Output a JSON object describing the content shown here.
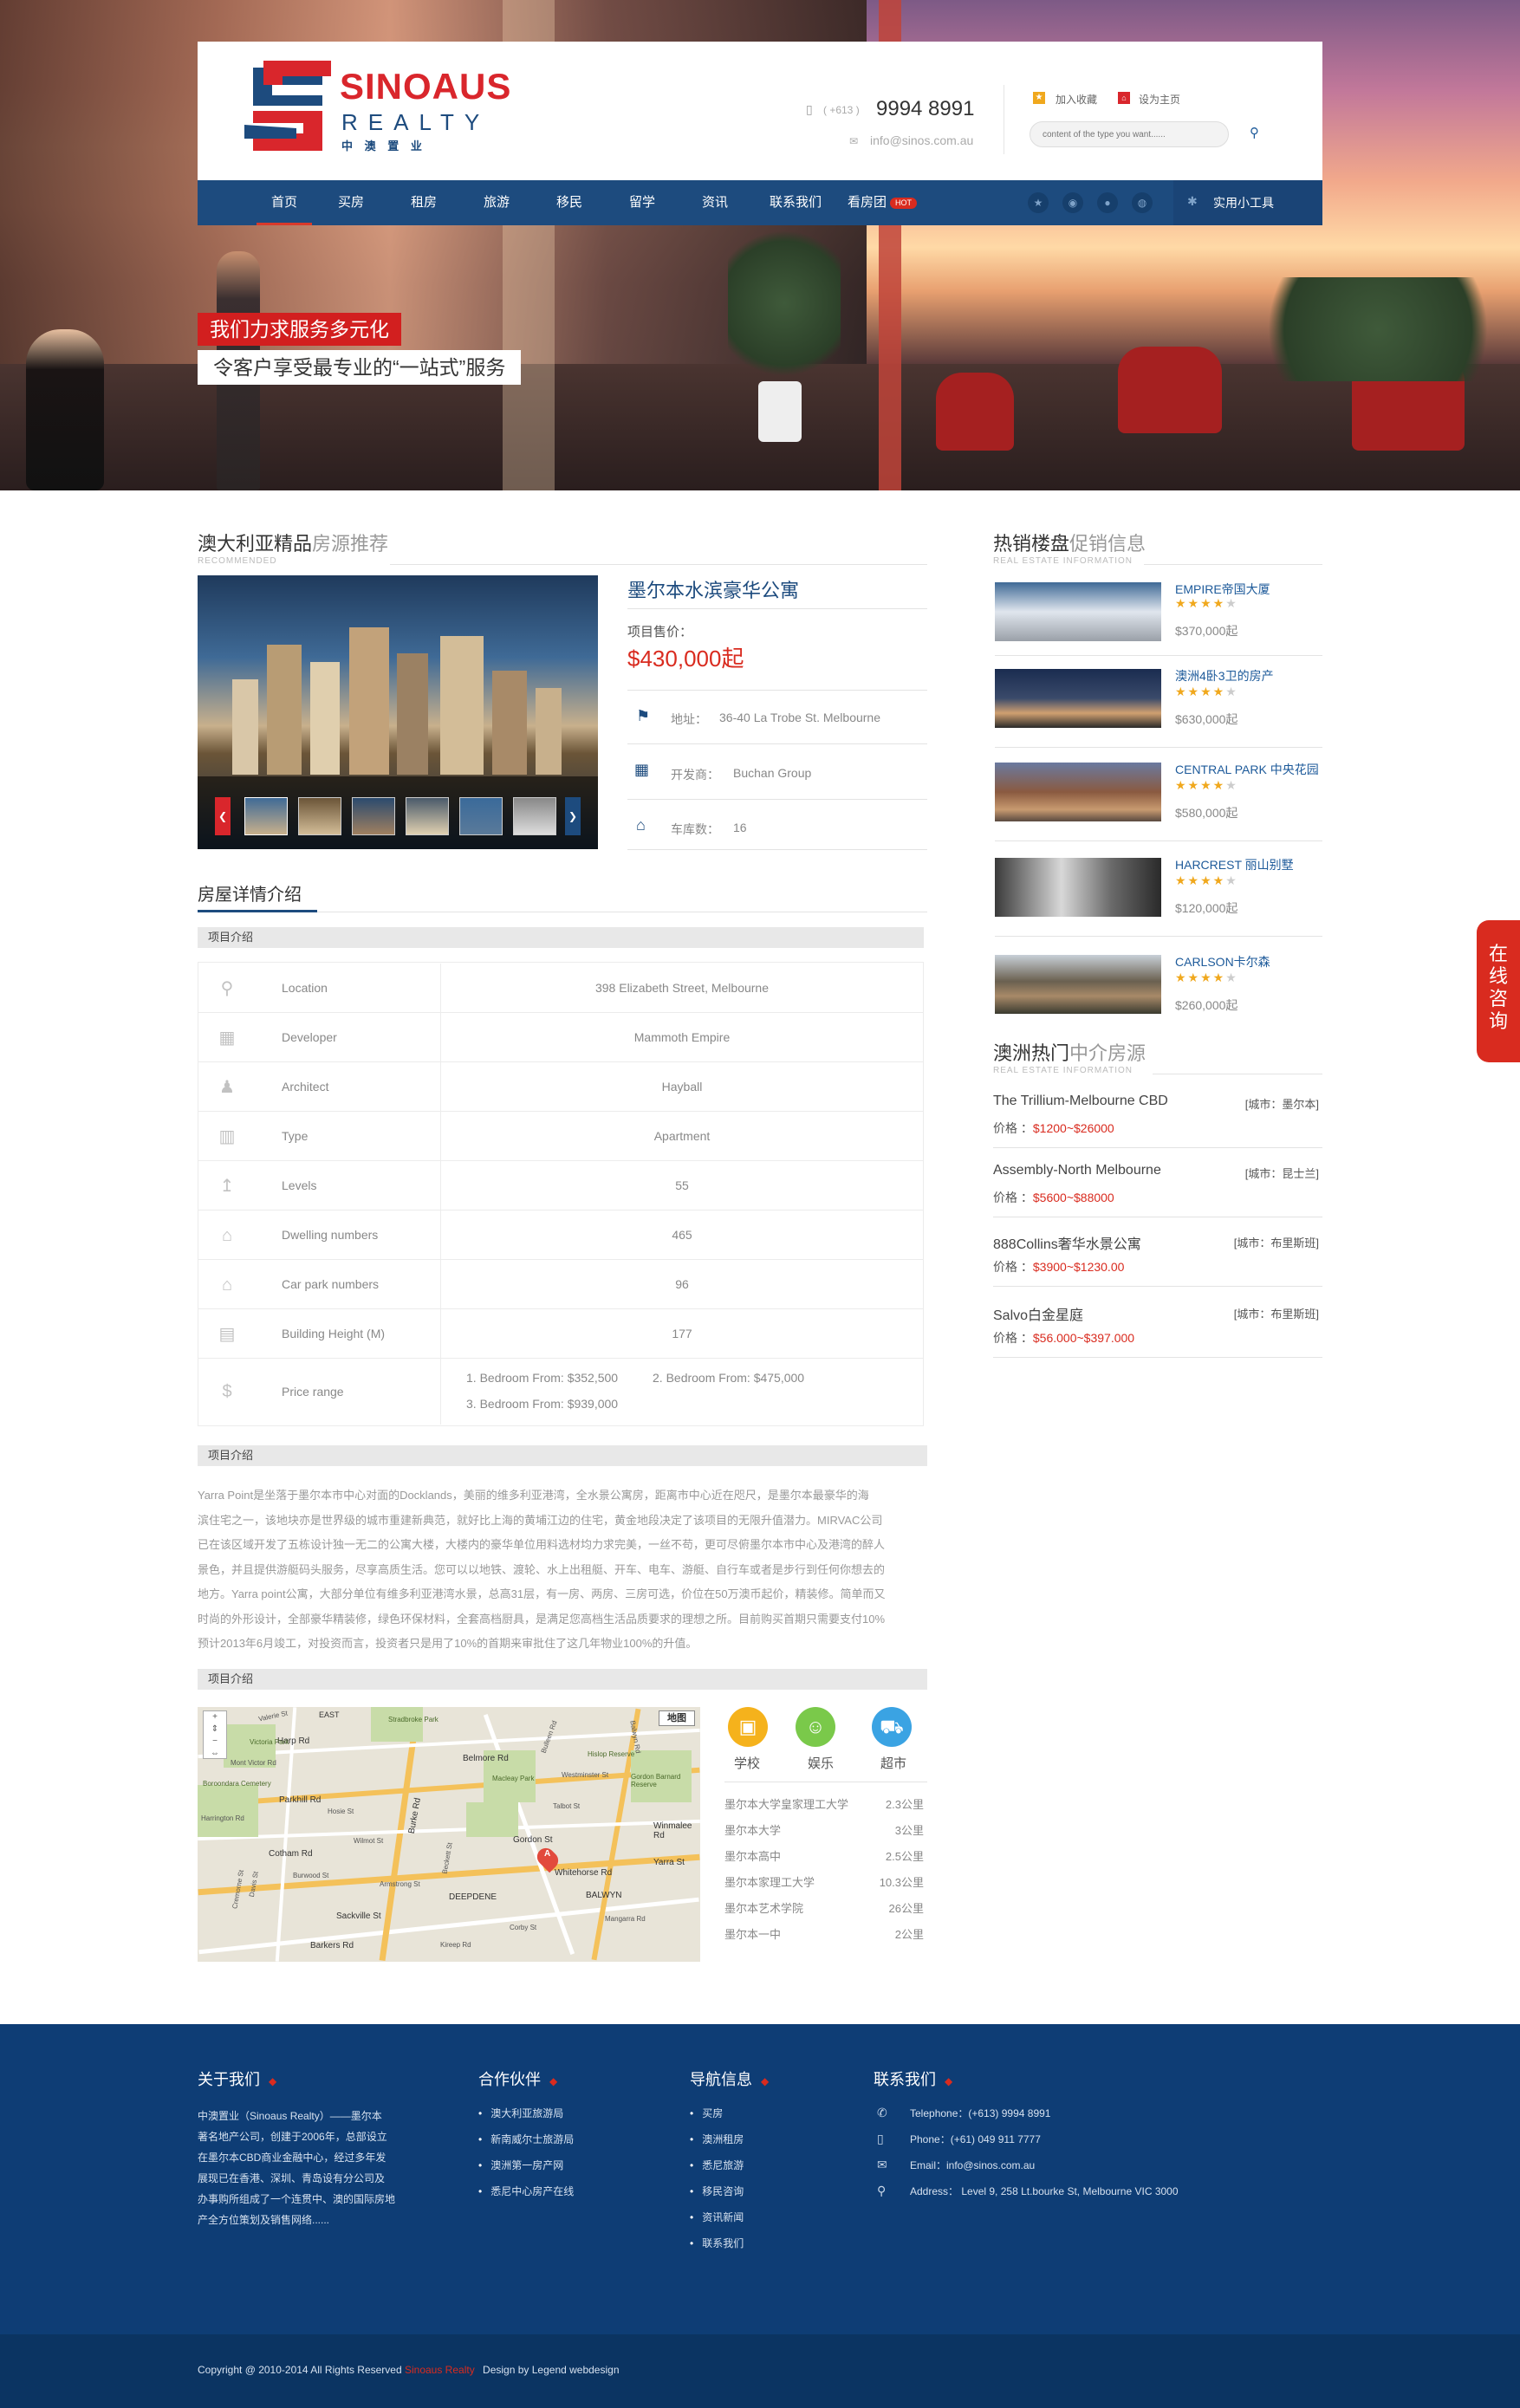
{
  "hero": {
    "slogan1": "我们力求服务多元化",
    "slogan2": "令客户享受最专业的“一站式”服务"
  },
  "header": {
    "logo_en1": "SINOAUS",
    "logo_en2": "REALTY",
    "logo_cn": "中 澳 置 业",
    "phone_prefix": "( +613 )",
    "phone": "9994 8991",
    "email": "info@sinos.com.au",
    "favorite": "加入收藏",
    "homepage": "设为主页",
    "search_placeholder": "content of the type you want......"
  },
  "nav": {
    "items": [
      "首页",
      "买房",
      "租房",
      "旅游",
      "移民",
      "留学",
      "资讯",
      "联系我们",
      "看房团"
    ],
    "hot": "HOT",
    "tools": "实用小工具"
  },
  "featured": {
    "title_main": "澳大利亚精品",
    "title_light": "房源推荐",
    "subtitle": "RECOMMENDED",
    "name": "墨尔本水滨豪华公寓",
    "price_label": "项目售价：",
    "price": "$430,000起",
    "address_label": "地址：",
    "address": "36-40 La Trobe St. Melbourne",
    "developer_label": "开发商：",
    "developer": "Buchan Group",
    "parking_label": "车库数：",
    "parking": "16"
  },
  "details": {
    "title": "房屋详情介绍",
    "bar1": "项目介绍",
    "rows": [
      {
        "label": "Location",
        "value": "398 Elizabeth Street, Melbourne"
      },
      {
        "label": "Developer",
        "value": "Mammoth Empire"
      },
      {
        "label": "Architect",
        "value": "Hayball"
      },
      {
        "label": "Type",
        "value": "Apartment"
      },
      {
        "label": "Levels",
        "value": "55"
      },
      {
        "label": "Dwelling numbers",
        "value": "465"
      },
      {
        "label": "Car park numbers",
        "value": "96"
      },
      {
        "label": "Building Height (M)",
        "value": "177"
      }
    ],
    "price_range_label": "Price range",
    "price_range": [
      "1. Bedroom From: $352,500",
      "2. Bedroom From: $475,000",
      "3. Bedroom From: $939,000"
    ],
    "bar2": "项目介绍",
    "desc": [
      "Yarra Point是坐落于墨尔本市中心对面的Docklands，美丽的维多利亚港湾，全水景公寓房，距离市中心近在咫尺，是墨尔本最豪华的海",
      "滨住宅之一，该地块亦是世界级的城市重建新典范，就好比上海的黄埔江边的住宅，黄金地段决定了该项目的无限升值潜力。MIRVAC公司",
      "已在该区域开发了五栋设计独一无二的公寓大楼，大楼内的豪华单位用料选材均力求完美，一丝不苟，更可尽俯墨尔本市中心及港湾的醉人",
      "景色，并且提供游艇码头服务，尽享高质生活。您可以以地铁、渡轮、水上出租艇、开车、电车、游艇、自行车或者是步行到任何你想去的",
      "地方。Yarra point公寓，大部分单位有维多利亚港湾水景，总高31层，有一房、两房、三房可选，价位在50万澳币起价，精装修。简单而又",
      "时尚的外形设计，全部豪华精装修，绿色环保材料，全套高档厨具，是满足您高档生活品质要求的理想之所。目前购买首期只需要支付10%",
      "预计2013年6月竣工，对投资而言，投资者只是用了10%的首期来审批住了这几年物业100%的升值。"
    ],
    "bar3": "项目介绍"
  },
  "map": {
    "map_button": "地图",
    "labels": [
      "Harp Rd",
      "Belmore Rd",
      "Parkhill Rd",
      "Cotham Rd",
      "Burke Rd",
      "Gordon St",
      "Whitehorse Rd",
      "Sackville St",
      "Barkers Rd",
      "DEEPDENE",
      "BALWYN",
      "Winmalee Rd",
      "Yarra St",
      "EAST",
      "Stradbroke Park",
      "Macleay Park",
      "Victoria Park",
      "Hislop Reserve",
      "Gordon Barnard Reserve",
      "Boroondara Cemetery",
      "Mont Victor Rd",
      "Valerie St",
      "Bulleen Rd",
      "Balwyn Rd",
      "Davis St",
      "Cremorne St",
      "Harrington Rd",
      "Hosie St",
      "Beckett St",
      "Armstrong St",
      "Talbot St",
      "Mangarra Rd",
      "Westminster St",
      "Corby St",
      "Burwood St",
      "Kireep Rd",
      "Wilmot St"
    ],
    "pin": "A",
    "categories": [
      "学校",
      "娱乐",
      "超市"
    ],
    "places": [
      {
        "name": "墨尔本大学皇家理工大学",
        "dist": "2.3公里"
      },
      {
        "name": "墨尔本大学",
        "dist": "3公里"
      },
      {
        "name": "墨尔本高中",
        "dist": "2.5公里"
      },
      {
        "name": "墨尔本家理工大学",
        "dist": "10.3公里"
      },
      {
        "name": "墨尔本艺术学院",
        "dist": "26公里"
      },
      {
        "name": "墨尔本一中",
        "dist": "2公里"
      }
    ]
  },
  "hot": {
    "title_main": "热销楼盘",
    "title_light": "促销信息",
    "subtitle": "REAL ESTATE INFORMATION",
    "items": [
      {
        "name": "EMPIRE帝国大厦",
        "stars": 4,
        "price": "$370,000起"
      },
      {
        "name": "澳洲4卧3卫的房产",
        "stars": 4,
        "price": "$630,000起"
      },
      {
        "name": "CENTRAL PARK 中央花园",
        "stars": 4,
        "price": "$580,000起"
      },
      {
        "name": "HARCREST 丽山别墅",
        "stars": 4,
        "price": "$120,000起"
      },
      {
        "name": "CARLSON卡尔森",
        "stars": 4,
        "price": "$260,000起"
      }
    ]
  },
  "agency": {
    "title_main": "澳洲热门",
    "title_light": "中介房源",
    "subtitle": "REAL ESTATE INFORMATION",
    "price_label": "价格 ：",
    "items": [
      {
        "name": "The Trillium-Melbourne CBD",
        "city": "[城市：墨尔本]",
        "price": "$1200~$26000"
      },
      {
        "name": "Assembly-North Melbourne",
        "city": "[城市：昆士兰]",
        "price": "$5600~$88000"
      },
      {
        "name": "888Collins奢华水景公寓",
        "city": "[城市：布里斯班]",
        "price": "$3900~$1230.00"
      },
      {
        "name": "Salvo白金星庭",
        "city": "[城市：布里斯班]",
        "price": "$56.000~$397.000"
      }
    ]
  },
  "side": {
    "consult": [
      "在",
      "线",
      "咨",
      "询"
    ]
  },
  "footer": {
    "about_title": "关于我们",
    "about_text": [
      "中澳置业（Sinoaus Realty）——墨尔本",
      "著名地产公司，创建于2006年，总部设立",
      "在墨尔本CBD商业金融中心，经过多年发",
      "展现已在香港、深圳、青岛设有分公司及",
      "办事购所组成了一个连贯中、澳的国际房地",
      "产全方位策划及销售网络......"
    ],
    "partners_title": "合作伙伴",
    "partners": [
      "澳大利亚旅游局",
      "新南威尔士旅游局",
      "澳洲第一房产网",
      "悉尼中心房产在线"
    ],
    "nav_title": "导航信息",
    "nav": [
      "买房",
      "澳洲租房",
      "悉尼旅游",
      "移民咨询",
      "资讯新闻",
      "联系我们"
    ],
    "contact_title": "联系我们",
    "contact": [
      {
        "icon": "phone-icon",
        "text": "Telephone：(+613) 9994 8991"
      },
      {
        "icon": "mobile-icon",
        "text": "Phone：(+61) 049 911 7777"
      },
      {
        "icon": "mail-icon",
        "text": "Email：info@sinos.com.au"
      },
      {
        "icon": "pin-icon",
        "text": "Address： Level 9, 258 Lt.bourke St, Melbourne VIC 3000"
      }
    ],
    "copyright": "Copyright @ 2010-2014 All Rights Reserved",
    "brand": "Sinoaus Realty",
    "design": "Design by Legend webdesign"
  }
}
